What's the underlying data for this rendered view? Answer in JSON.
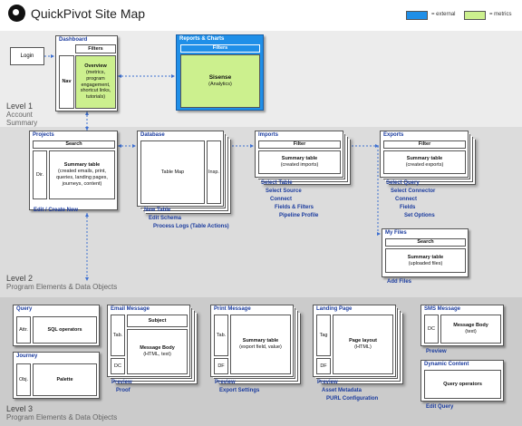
{
  "header": {
    "title": "QuickPivot Site Map"
  },
  "legend": {
    "external_label": "= external",
    "metrics_label": "= metrics",
    "external_color": "#1f8fe8",
    "metrics_color": "#ccf08e"
  },
  "levels": {
    "l1": {
      "name": "Level 1",
      "desc": "Account Summary"
    },
    "l2": {
      "name": "Level 2",
      "desc": "Program Elements & Data Objects"
    },
    "l3": {
      "name": "Level 3",
      "desc": "Program Elements & Data Objects"
    }
  },
  "login": "Login",
  "dashboard": {
    "title": "Dashboard",
    "filters": "Filters",
    "nav": "Nav",
    "overview_title": "Overview",
    "overview_text": "(metrics, program engagement, shortcut links, tutorials)"
  },
  "reports": {
    "title": "Reports & Charts",
    "filters": "Filters",
    "sisense": "Sisense",
    "sisense_sub": "(Analytics)"
  },
  "projects": {
    "title": "Projects",
    "search": "Search",
    "dir": "Dir.",
    "summary_title": "Summary table",
    "summary_text": "(created emails, print, queries, landing pages, journeys, content)",
    "link": "Edit / Create New"
  },
  "database": {
    "title": "Database",
    "table_map": "Table Map",
    "insp": "Insp.",
    "links": [
      "New Table",
      "Edit Schema",
      "Process Logs (Table Actions)"
    ]
  },
  "imports": {
    "title": "Imports",
    "filter": "Filter",
    "summary_title": "Summary table",
    "summary_text": "(created imports)",
    "links": [
      "Select Table",
      "Select Source",
      "Connect",
      "Fields & Filters",
      "Pipeline Profile"
    ]
  },
  "exports": {
    "title": "Exports",
    "filter": "Filter",
    "summary_title": "Summary table",
    "summary_text": "(created exports)",
    "links": [
      "Select Query",
      "Select Connector",
      "Connect",
      "Fields",
      "Set Options"
    ]
  },
  "myfiles": {
    "title": "My Files",
    "search": "Search",
    "summary_title": "Summary table",
    "summary_text": "(uploaded files)",
    "link": "Add Files"
  },
  "query": {
    "title": "Query",
    "attr": "Attr.",
    "ops": "SQL operators"
  },
  "journey": {
    "title": "Journey",
    "obj": "Obj.",
    "palette": "Palette"
  },
  "email": {
    "title": "Email Message",
    "subject": "Subject",
    "tab": "Tab.",
    "dc": "DC",
    "body_title": "Message Body",
    "body_text": "(HTML, text)",
    "links": [
      "Preview",
      "Proof"
    ]
  },
  "print": {
    "title": "Print Message",
    "tab": "Tab.",
    "df": "DF",
    "summary_title": "Summary table",
    "summary_text": "(export field, value)",
    "links": [
      "Preview",
      "Export Settings"
    ]
  },
  "landing": {
    "title": "Landing Page",
    "tag": "Tag",
    "df": "DF",
    "layout_title": "Page layout",
    "layout_text": "(HTML)",
    "links": [
      "Preview",
      "Asset Metadata",
      "PURL Configuration"
    ]
  },
  "sms": {
    "title": "SMS Message",
    "dc": "DC",
    "body_title": "Message Body",
    "body_text": "(text)",
    "link": "Preview"
  },
  "dynamic": {
    "title": "Dynamic Content",
    "ops": "Query operators",
    "link": "Edit Query"
  }
}
